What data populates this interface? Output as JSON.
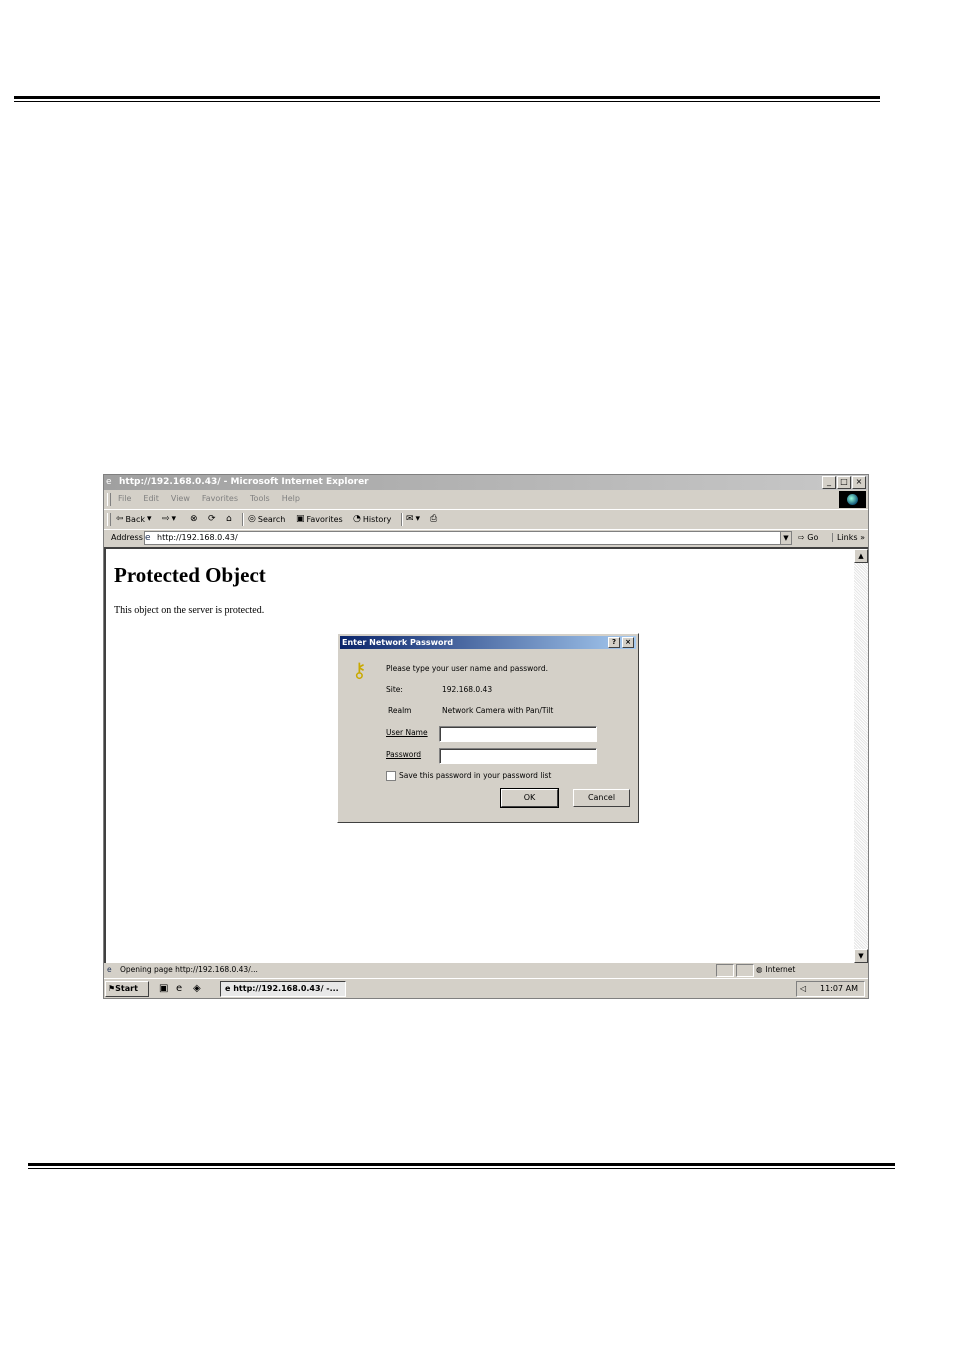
{
  "browser": {
    "window_title": "http://192.168.0.43/ - Microsoft Internet Explorer",
    "window_buttons": [
      "_",
      "□",
      "×"
    ],
    "menu": [
      "File",
      "Edit",
      "View",
      "Favorites",
      "Tools",
      "Help"
    ],
    "toolbar": {
      "back_label": "Back",
      "search_label": "Search",
      "favorites_label": "Favorites",
      "history_label": "History"
    },
    "address": {
      "label": "Address",
      "url": "http://192.168.0.43/",
      "go_label": "Go",
      "links_label": "Links"
    },
    "status_text": "Opening page http://192.168.0.43/...",
    "zone_label": "Internet"
  },
  "page": {
    "heading": "Protected Object",
    "text": "This object on the server is protected."
  },
  "dialog": {
    "title": "Enter Network Password",
    "title_buttons": [
      "?",
      "×"
    ],
    "prompt": "Please type your user name and password.",
    "site_label": "Site:",
    "site_value": "192.168.0.43",
    "realm_label": "Realm",
    "realm_value": "Network Camera with Pan/Tilt",
    "username_label": "User Name",
    "username_value": "",
    "password_label": "Password",
    "password_value": "",
    "save_label": "Save this password in your password list",
    "ok_label": "OK",
    "cancel_label": "Cancel"
  },
  "taskbar": {
    "start_label": "Start",
    "task_label": "http://192.168.0.43/ -...",
    "clock": "11:07 AM"
  }
}
